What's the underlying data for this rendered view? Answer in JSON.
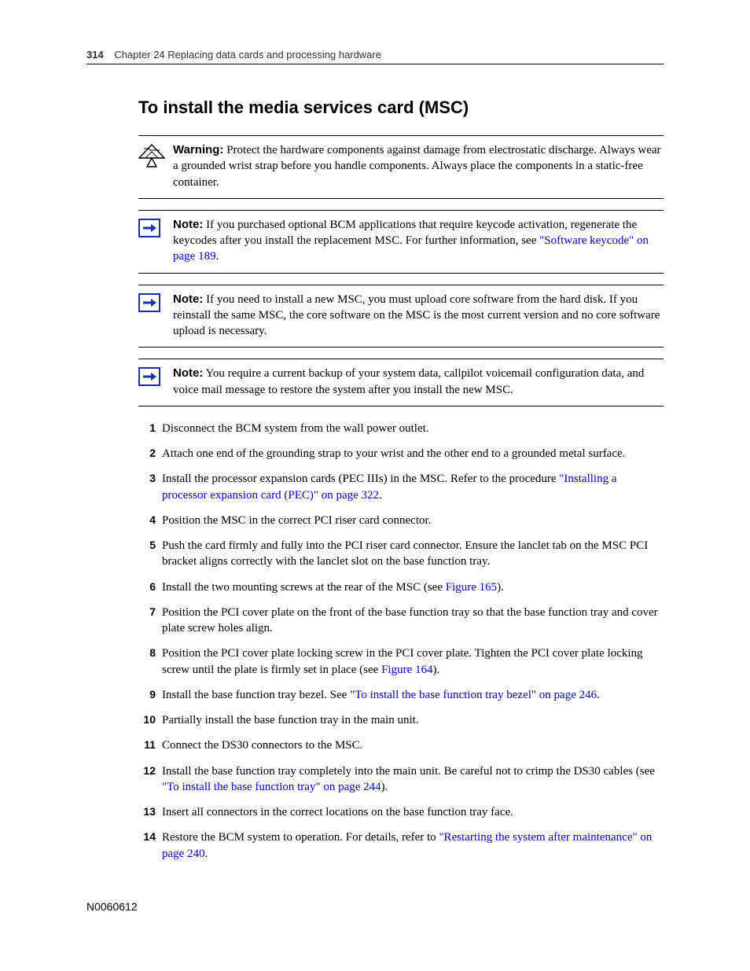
{
  "header": {
    "page_number": "314",
    "chapter_line": "Chapter 24   Replacing data cards and processing hardware"
  },
  "title": "To install the media services card (MSC)",
  "callouts": [
    {
      "icon": "warning",
      "lead": "Warning:",
      "body_before": " Protect the hardware components against damage from electrostatic discharge. Always wear a grounded wrist strap before you handle components. Always place the components in a static-free container.",
      "link_text": "",
      "body_after": ""
    },
    {
      "icon": "note",
      "lead": "Note:",
      "body_before": " If you purchased optional BCM applications that require keycode activation, regenerate the keycodes after you install the replacement MSC. For further information, see ",
      "link_text": "\"Software keycode\" on page 189",
      "body_after": "."
    },
    {
      "icon": "note",
      "lead": "Note:",
      "body_before": " If you need to install a new MSC, you must upload core software from the hard disk. If you reinstall the same MSC, the core software on the MSC is the most current version and no core software upload is necessary.",
      "link_text": "",
      "body_after": ""
    },
    {
      "icon": "note",
      "lead": "Note:",
      "body_before": " You require a current backup of your system data, callpilot voicemail configuration data, and voice mail message to restore the system after you install the new MSC.",
      "link_text": "",
      "body_after": ""
    }
  ],
  "steps": [
    {
      "pre": "Disconnect the BCM system from the wall power outlet.",
      "link": "",
      "post": ""
    },
    {
      "pre": "Attach one end of the grounding strap to your wrist and the other end to a grounded metal surface.",
      "link": "",
      "post": ""
    },
    {
      "pre": "Install the processor expansion cards (PEC IIIs) in the MSC. Refer to the procedure ",
      "link": "\"Installing a processor expansion card (PEC)\" on page 322",
      "post": "."
    },
    {
      "pre": "Position the MSC in the correct PCI riser card connector.",
      "link": "",
      "post": ""
    },
    {
      "pre": "Push the card firmly and fully into the PCI riser card connector. Ensure the lanclet tab on the MSC PCI bracket aligns correctly with the lanclet slot on the base function tray.",
      "link": "",
      "post": ""
    },
    {
      "pre": "Install the two mounting screws at the rear of the MSC (see ",
      "link": "Figure 165",
      "post": ")."
    },
    {
      "pre": "Position the PCI cover plate on the front of the base function tray so that the base function tray and cover plate screw holes align.",
      "link": "",
      "post": ""
    },
    {
      "pre": "Position the PCI cover plate locking screw in the PCI cover plate. Tighten the PCI cover plate locking screw until the plate is firmly set in place (see ",
      "link": "Figure 164",
      "post": ")."
    },
    {
      "pre": "Install the base function tray bezel. See ",
      "link": "\"To install the base function tray bezel\" on page 246",
      "post": "."
    },
    {
      "pre": "Partially install the base function tray in the main unit.",
      "link": "",
      "post": ""
    },
    {
      "pre": "Connect the DS30 connectors to the MSC.",
      "link": "",
      "post": ""
    },
    {
      "pre": "Install the base function tray completely into the main unit. Be careful not to crimp the DS30 cables (see ",
      "link": "\"To install the base function tray\" on page 244",
      "post": ")."
    },
    {
      "pre": "Insert all connectors in the correct locations on the base function tray face.",
      "link": "",
      "post": ""
    },
    {
      "pre": "Restore the BCM system to operation. For details, refer to ",
      "link": "\"Restarting the system after maintenance\" on page 240",
      "post": "."
    }
  ],
  "doc_number": "N0060612"
}
